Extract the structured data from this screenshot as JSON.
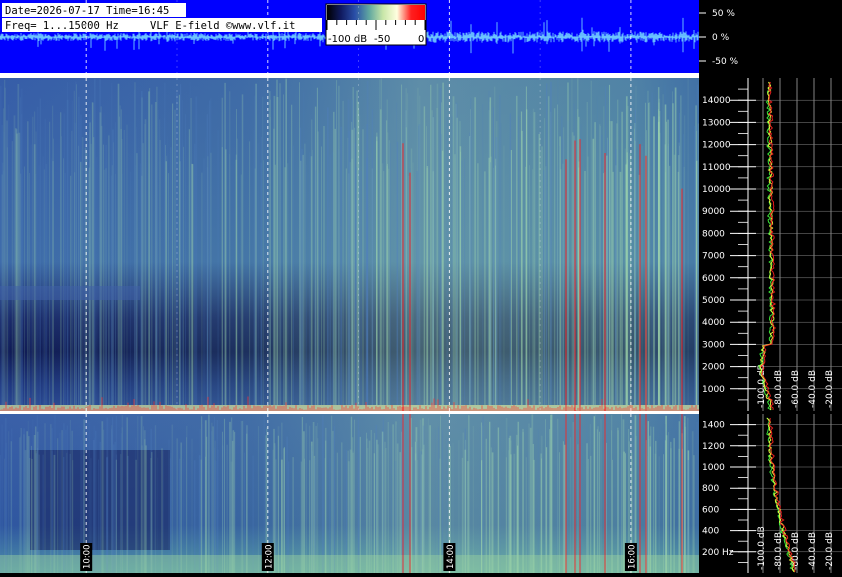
{
  "header": {
    "date_time": "Date=2026-07-17 Time=16:45",
    "freq_range": "Freq= 1...15000 Hz",
    "source": "VLF E-field ©www.vlf.it"
  },
  "color_scale": {
    "labels": [
      "-100 dB",
      "-50",
      "0"
    ],
    "stops": [
      "#000000",
      "#101a60",
      "#2a4fa8",
      "#5fa6a0",
      "#c8e6a8",
      "#ffffe0",
      "#ff2020",
      "#ff0000"
    ]
  },
  "colors": {
    "waveform_bg": "#0000ff",
    "waveform": "#7fe8ff",
    "spectrogram_base": "#27408f",
    "spectrum_red": "#ff2020",
    "spectrum_yellow": "#ffff40",
    "spectrum_green": "#40ff40"
  },
  "chart_data": [
    {
      "type": "line",
      "name": "waveform",
      "y_ticks": [
        "50 %",
        "0 %",
        "-50 %"
      ],
      "y_tick_values": [
        50,
        0,
        -50
      ],
      "ylim": [
        -75,
        75
      ]
    },
    {
      "type": "heatmap",
      "name": "spectrogram-upper",
      "y_ticks": [
        "14000",
        "13000",
        "12000",
        "11000",
        "10000",
        "9000",
        "8000",
        "7000",
        "6000",
        "5000",
        "4000",
        "3000",
        "2000",
        "1000"
      ],
      "y_tick_values": [
        14000,
        13000,
        12000,
        11000,
        10000,
        9000,
        8000,
        7000,
        6000,
        5000,
        4000,
        3000,
        2000,
        1000
      ],
      "ylim": [
        0,
        15000
      ],
      "spectrum_x_ticks": [
        "-100.0 dB",
        "-80.0 dB",
        "-60.0 dB",
        "-40.0 dB",
        "-20.0 dB"
      ]
    },
    {
      "type": "heatmap",
      "name": "spectrogram-lower",
      "y_ticks": [
        "1400",
        "1200",
        "1000",
        "800",
        "600",
        "400",
        "200 Hz"
      ],
      "y_tick_values": [
        1400,
        1200,
        1000,
        800,
        600,
        400,
        200
      ],
      "ylim": [
        0,
        1500
      ],
      "spectrum_x_ticks": [
        "-100.0 dB",
        "-80.0 dB",
        "-60.0 dB",
        "-40.0 dB",
        "-20.0 dB"
      ]
    }
  ],
  "time_axis": {
    "labels": [
      "10:00",
      "12:00",
      "14:00",
      "16:00"
    ],
    "hours": [
      10,
      12,
      14,
      16
    ],
    "start_hour": 9.05,
    "end_hour": 16.75
  }
}
